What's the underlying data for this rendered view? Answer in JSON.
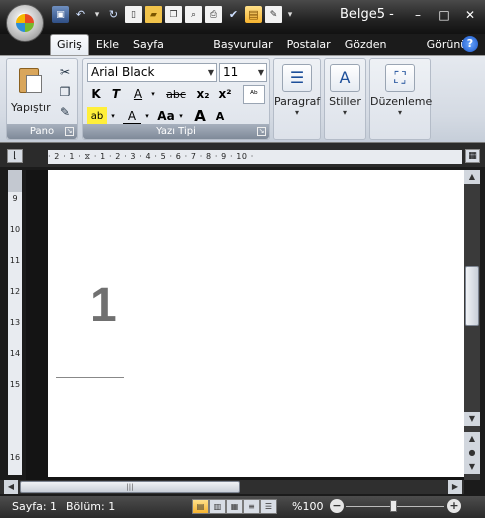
{
  "window": {
    "title": "Belge5 -",
    "minimize": "–",
    "maximize": "□",
    "close": "✕"
  },
  "tabs": [
    "Giriş",
    "Ekle",
    "Sayfa Düzeni",
    "Başvurular",
    "Postalar",
    "Gözden Geçir",
    "Görünüm"
  ],
  "active_tab": "Giriş",
  "ribbon": {
    "clipboard": {
      "paste_label": "Yapıştır",
      "group_label": "Pano"
    },
    "font": {
      "font_name": "Arial Black",
      "font_size": "11",
      "group_label": "Yazı Tipi",
      "bold": "K",
      "italic": "T",
      "underline": "A",
      "strike": "abc",
      "subscript": "x₂",
      "superscript": "x²",
      "change_case": "Aa",
      "grow": "A",
      "shrink": "A",
      "highlight": "ab",
      "font_color": "A"
    },
    "paragraph_label": "Paragraf",
    "styles_label": "Stiller",
    "editing_label": "Düzenleme"
  },
  "ruler": {
    "horizontal": "· 2 · 1 · ⧖ · 1 · 2 · 3 · 4 · 5 · 6 · 7 · 8 · 9 · 10 ·",
    "vertical": [
      "9",
      "10",
      "11",
      "12",
      "13",
      "14",
      "15",
      "16"
    ]
  },
  "document": {
    "page_number": "1"
  },
  "status": {
    "page": "Sayfa: 1",
    "section": "Bölüm: 1",
    "zoom": "%100"
  }
}
